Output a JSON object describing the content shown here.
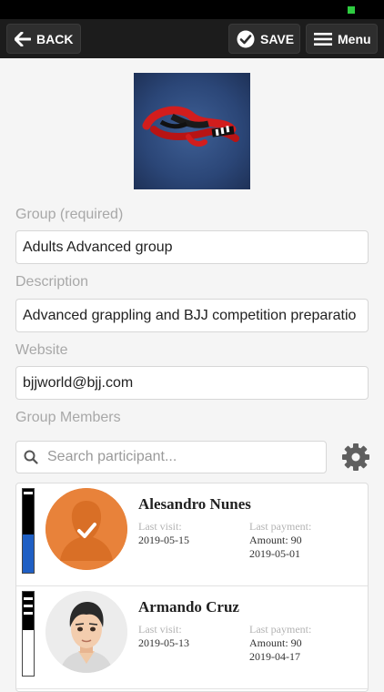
{
  "toolbar": {
    "back_label": "BACK",
    "save_label": "SAVE",
    "menu_label": "Menu"
  },
  "form": {
    "group_label": "Group (required)",
    "group_value": "Adults Advanced group",
    "description_label": "Description",
    "description_value": "Advanced grappling and BJJ competition preparatio",
    "website_label": "Website",
    "website_value": "bjjworld@bjj.com",
    "members_label": "Group Members",
    "search_placeholder": "Search participant..."
  },
  "members": [
    {
      "name": "Alesandro Nunes",
      "last_visit_label": "Last visit:",
      "last_visit": "2019-05-15",
      "last_payment_label": "Last payment:",
      "amount": "Amount: 90",
      "payment_date": "2019-05-01",
      "avatar": "default-person-checked-icon",
      "belt": "blue-belt"
    },
    {
      "name": "Armando Cruz",
      "last_visit_label": "Last visit:",
      "last_visit": "2019-05-13",
      "last_payment_label": "Last payment:",
      "amount": "Amount: 90",
      "payment_date": "2019-04-17",
      "avatar": "cartoon-man-avatar",
      "belt": "white-belt"
    }
  ],
  "colors": {
    "topbar": "#1c1c1c",
    "button": "#2e2e2e",
    "avatar_orange": "#e8823a",
    "belt_blue": "#1f5fc4"
  }
}
